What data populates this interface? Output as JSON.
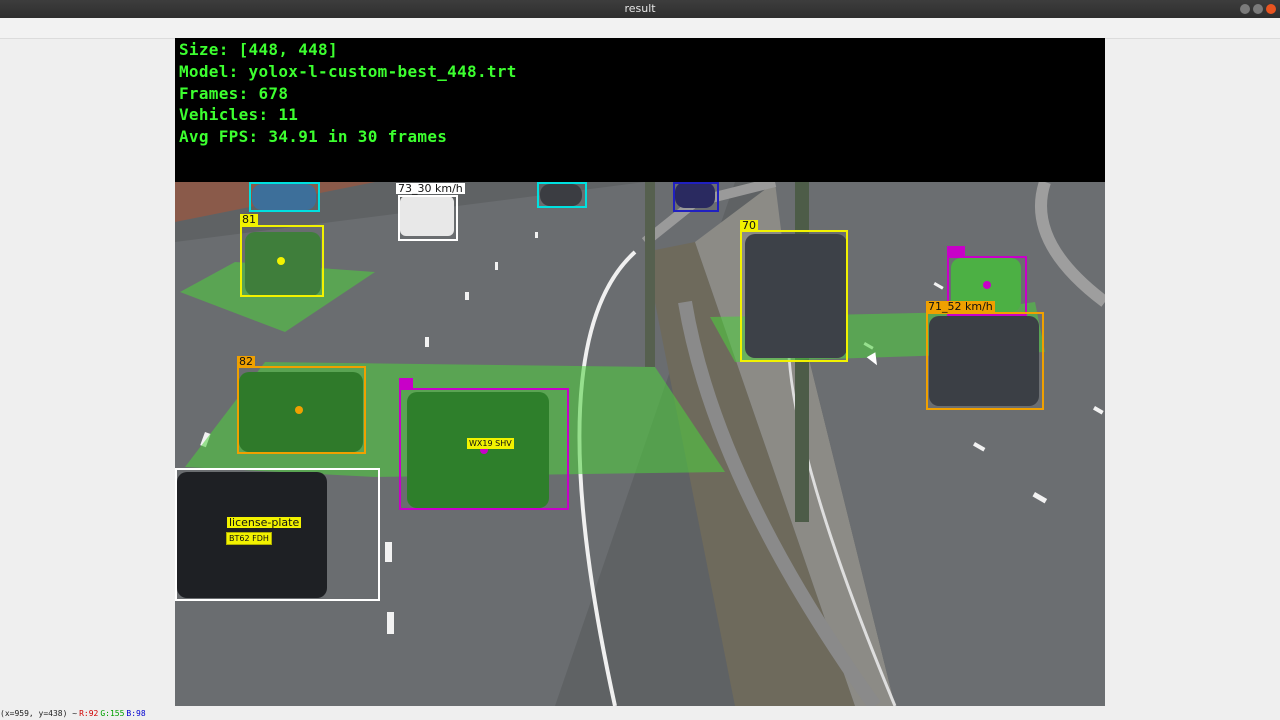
{
  "window": {
    "title": "result"
  },
  "overlay": {
    "size": "Size: [448, 448]",
    "model": "Model: yolox-l-custom-best_448.trt",
    "frames": "Frames: 678",
    "vehicles": "Vehicles: 11",
    "fps": "Avg FPS: 34.91 in 30 frames"
  },
  "detections": {
    "d81": "81",
    "d82": "82",
    "d70": "70",
    "speed1": "73_30 km/h",
    "speed2": "71_52 km/h",
    "plate": "license-plate",
    "plate_text": "BT62 FDH",
    "plate_text2": "WX19 SHV"
  },
  "colors": {
    "overlay_text": "#3cff2f",
    "zone": "#4cd23c",
    "yellow": "#f2f200",
    "orange": "#f0a000",
    "magenta": "#c800c8",
    "cyan": "#00e0e0",
    "white": "#ffffff",
    "blue": "#2020c0"
  },
  "statusbar": {
    "coords": "(x=959, y=438) ~",
    "r": "R:92",
    "g": "G:155",
    "b": "B:98"
  }
}
